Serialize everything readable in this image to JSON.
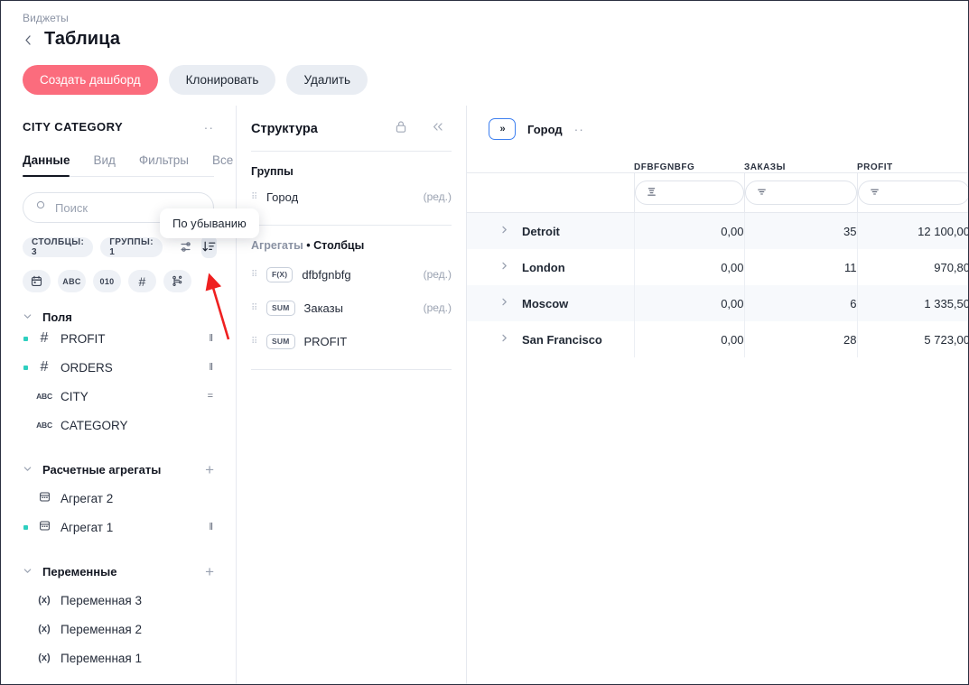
{
  "breadcrumb": "Виджеты",
  "page_title": "Таблица",
  "actions": {
    "primary": "Создать дашборд",
    "clone": "Клонировать",
    "delete": "Удалить"
  },
  "left_panel": {
    "dataset_name": "CITY CATEGORY",
    "tabs": [
      {
        "label": "Данные",
        "active": true
      },
      {
        "label": "Вид",
        "active": false
      },
      {
        "label": "Фильтры",
        "active": false
      },
      {
        "label": "Все",
        "active": false
      }
    ],
    "search_placeholder": "Поиск",
    "search_value": "",
    "chips": [
      {
        "label": "СТОЛБЦЫ: 3"
      },
      {
        "label": "ГРУППЫ: 1"
      }
    ],
    "settings_icon": "sliders-icon",
    "sort_icon": "sort-descending-icon",
    "type_pills": [
      {
        "name": "calendar-icon",
        "label": ""
      },
      {
        "name": "abc-icon",
        "label": "ABC"
      },
      {
        "name": "binary-icon",
        "label": "010"
      },
      {
        "name": "hash-icon",
        "label": "#"
      },
      {
        "name": "hierarchy-icon",
        "label": ""
      }
    ],
    "sections": [
      {
        "title": "Поля",
        "has_add": false,
        "items": [
          {
            "marker": true,
            "icon": "hash",
            "icon_text": "#",
            "label": "PROFIT",
            "meta": "‖"
          },
          {
            "marker": true,
            "icon": "hash",
            "icon_text": "#",
            "label": "ORDERS",
            "meta": "‖"
          },
          {
            "marker": false,
            "icon": "abc",
            "icon_text": "ABC",
            "label": "CITY",
            "meta": "="
          },
          {
            "marker": false,
            "icon": "abc",
            "icon_text": "ABC",
            "label": "CATEGORY",
            "meta": ""
          }
        ]
      },
      {
        "title": "Расчетные агрегаты",
        "has_add": true,
        "items": [
          {
            "marker": false,
            "icon": "calc",
            "icon_text": "▤",
            "label": "Агрегат 2",
            "meta": ""
          },
          {
            "marker": true,
            "icon": "calc",
            "icon_text": "▤",
            "label": "Агрегат 1",
            "meta": "‖"
          }
        ]
      },
      {
        "title": "Переменные",
        "has_add": true,
        "items": [
          {
            "marker": false,
            "icon": "varx",
            "icon_text": "(x)",
            "label": "Переменная 3",
            "meta": ""
          },
          {
            "marker": false,
            "icon": "varx",
            "icon_text": "(x)",
            "label": "Переменная 2",
            "meta": ""
          },
          {
            "marker": false,
            "icon": "varx",
            "icon_text": "(x)",
            "label": "Переменная 1",
            "meta": ""
          }
        ]
      }
    ]
  },
  "tooltip": {
    "text": "По убыванию"
  },
  "mid_panel": {
    "title": "Структура",
    "lock_icon": "lock-icon",
    "collapse_icon": "chevrons-left-icon",
    "groups_title": "Группы",
    "groups": [
      {
        "label": "Город",
        "edit": "(ред.)"
      }
    ],
    "aggregates_title_muted": "Агрегаты",
    "aggregates_title_sep": " • ",
    "aggregates_title": "Столбцы",
    "aggregates": [
      {
        "tag": "F(X)",
        "label": "dfbfgnbfg",
        "edit": "(ред.)"
      },
      {
        "tag": "SUM",
        "label": "Заказы",
        "edit": "(ред.)"
      },
      {
        "tag": "SUM",
        "label": "PROFIT",
        "edit": ""
      }
    ]
  },
  "right_panel": {
    "expand_button": "»",
    "group_label": "Город",
    "dots": "··",
    "columns": [
      "",
      "DFBFGNBFG",
      "ЗАКАЗЫ",
      "PROFIT"
    ],
    "filters": [
      "",
      "sort-icon",
      "filter-icon",
      "filter-icon"
    ],
    "rows": [
      {
        "name": "Detroit",
        "values": [
          "0,00",
          "35",
          "12 100,00"
        ]
      },
      {
        "name": "London",
        "values": [
          "0,00",
          "11",
          "970,80"
        ]
      },
      {
        "name": "Moscow",
        "values": [
          "0,00",
          "6",
          "1 335,50"
        ]
      },
      {
        "name": "San Francisco",
        "values": [
          "0,00",
          "28",
          "5 723,00"
        ]
      }
    ]
  },
  "colors": {
    "primary": "#fb6c7d",
    "secondary": "#e9edf3",
    "accent_blue": "#3d7ff0",
    "marker_teal": "#2ecfbf",
    "annotation_red": "#ef2020"
  }
}
